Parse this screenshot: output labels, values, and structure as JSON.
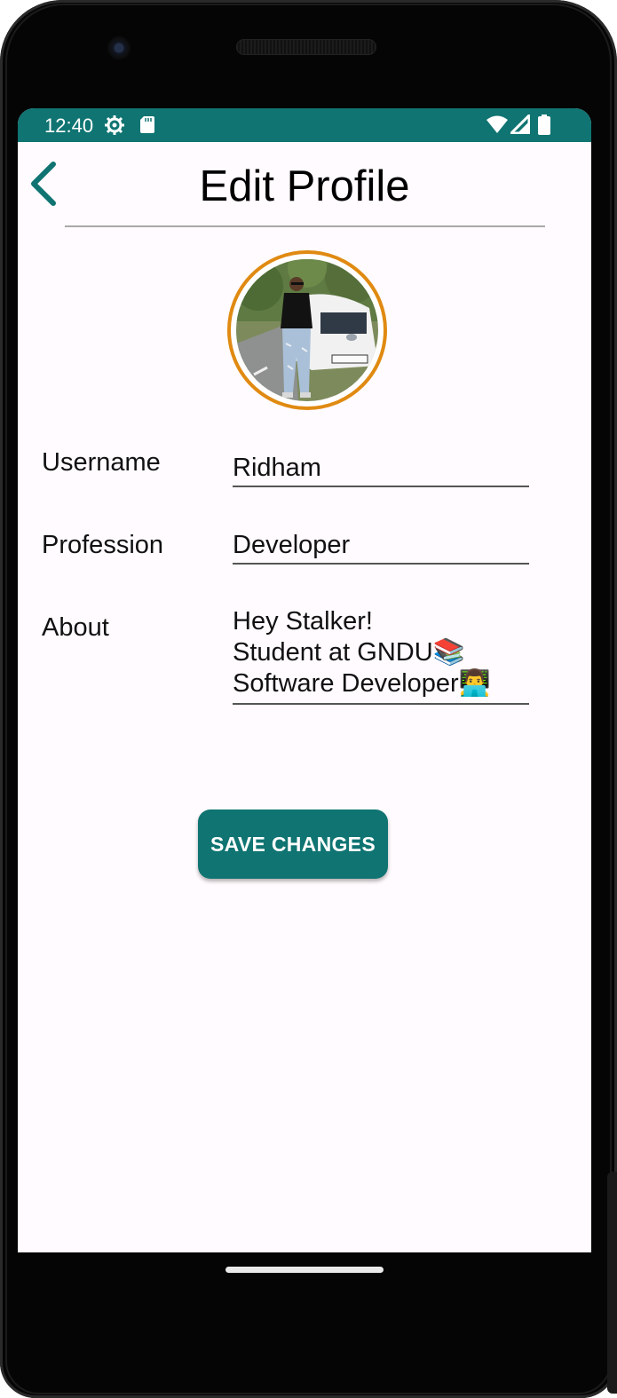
{
  "status_bar": {
    "time": "12:40",
    "icons": [
      "settings-gear-icon",
      "sd-card-icon",
      "wifi-icon",
      "cellular-signal-icon",
      "battery-icon"
    ]
  },
  "app_bar": {
    "title": "Edit Profile",
    "back_icon": "chevron-left-icon"
  },
  "profile": {
    "avatar_border_color": "#e08a12",
    "fields": {
      "username": {
        "label": "Username",
        "value": "Ridham"
      },
      "profession": {
        "label": "Profession",
        "value": "Developer"
      },
      "about": {
        "label": "About",
        "lines": [
          "Hey Stalker!",
          "Student at GNDU📚",
          "Software Developer👨‍💻"
        ]
      }
    }
  },
  "actions": {
    "save_label": "SAVE CHANGES"
  },
  "colors": {
    "primary": "#0f7472",
    "accent": "#e08a12",
    "background": "#fffbfe"
  }
}
